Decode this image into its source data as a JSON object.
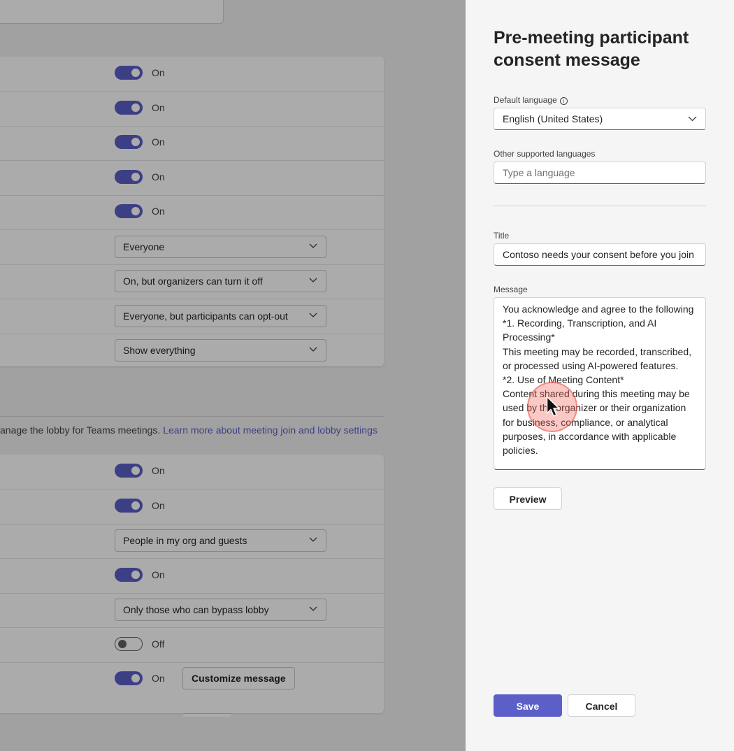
{
  "background": {
    "card1_rows": [
      {
        "type": "toggle",
        "state": "on",
        "label": "On"
      },
      {
        "type": "toggle",
        "state": "on",
        "label": "On"
      },
      {
        "type": "toggle",
        "state": "on",
        "label": "On"
      },
      {
        "type": "toggle",
        "state": "on",
        "label": "On"
      },
      {
        "type": "toggle",
        "state": "on",
        "label": "On"
      },
      {
        "type": "select",
        "value": "Everyone"
      },
      {
        "type": "select",
        "value": "On, but organizers can turn it off"
      },
      {
        "type": "select",
        "value": "Everyone, but participants can opt-out"
      },
      {
        "type": "select",
        "value": "Show everything"
      }
    ],
    "section_desc": "anage the lobby for Teams meetings.",
    "section_link": "Learn more about meeting join and lobby settings",
    "card2_rows": [
      {
        "type": "toggle",
        "state": "on",
        "label": "On"
      },
      {
        "type": "toggle",
        "state": "on",
        "label": "On"
      },
      {
        "type": "select",
        "value": "People in my org and guests"
      },
      {
        "type": "toggle",
        "state": "on",
        "label": "On"
      },
      {
        "type": "select",
        "value": "Only those who can bypass lobby"
      },
      {
        "type": "toggle",
        "state": "off",
        "label": "Off"
      },
      {
        "type": "toggle",
        "state": "on",
        "label": "On",
        "button": "Customize message"
      }
    ]
  },
  "panel": {
    "title": "Pre-meeting participant consent message",
    "default_language": {
      "label": "Default language",
      "value": "English (United States)"
    },
    "other_languages": {
      "label": "Other supported languages",
      "placeholder": "Type a language"
    },
    "title_field": {
      "label": "Title",
      "value": "Contoso needs your consent before you join"
    },
    "message_field": {
      "label": "Message",
      "value": "You acknowledge and agree to the following\n*1. Recording, Transcription, and AI Processing*\nThis meeting may be recorded, transcribed, or processed using AI-powered features.\n*2. Use of Meeting Content*\nContent shared during this meeting may be used by the organizer or their organization for business, compliance, or analytical purposes, in accordance with applicable policies."
    },
    "preview_label": "Preview",
    "save_label": "Save",
    "cancel_label": "Cancel"
  },
  "colors": {
    "accent": "#5b5fc7",
    "panel_bg": "#f5f5f5",
    "cursor_highlight": "#f0645a"
  }
}
